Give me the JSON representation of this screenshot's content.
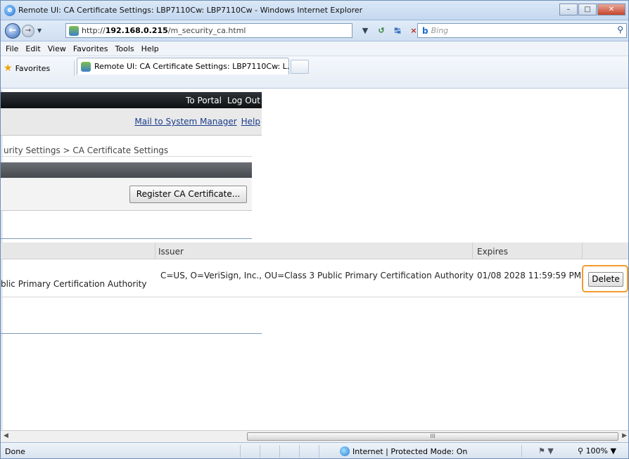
{
  "window": {
    "title": "Remote UI: CA Certificate Settings: LBP7110Cw: LBP7110Cw - Windows Internet Explorer",
    "icon": "ie-icon"
  },
  "address": {
    "url_prefix": "http://",
    "url_host": "192.168.0.215",
    "url_path": "/m_security_ca.html"
  },
  "search": {
    "provider": "Bing",
    "placeholder": "Bing"
  },
  "menu": [
    "File",
    "Edit",
    "View",
    "Favorites",
    "Tools",
    "Help"
  ],
  "favorites": {
    "label": "Favorites",
    "tab_title": "Remote UI: CA Certificate Settings: LBP7110Cw: L..."
  },
  "page": {
    "top_links": {
      "portal": "To Portal",
      "logout": "Log Out"
    },
    "secondary_links": {
      "mail": "Mail to System Manager",
      "help": "Help"
    },
    "breadcrumb": "urity Settings > CA Certificate Settings",
    "register_button": "Register CA Certificate...",
    "table": {
      "headers": {
        "issuer": "Issuer",
        "expires": "Expires"
      },
      "rows": [
        {
          "subject": "blic Primary Certification Authority",
          "issuer": "C=US, O=VeriSign, Inc., OU=Class 3 Public Primary Certification Authority",
          "expires": "01/08 2028 11:59:59 PM",
          "action": "Delete"
        }
      ]
    }
  },
  "scrollbar": {
    "thumb_grip": "III"
  },
  "status": {
    "left": "Done",
    "zone": "Internet | Protected Mode: On",
    "zoom": "100%"
  },
  "colors": {
    "highlight": "#f39a2a",
    "portal_bar": "#0e1012",
    "link": "#1a3c8c"
  }
}
